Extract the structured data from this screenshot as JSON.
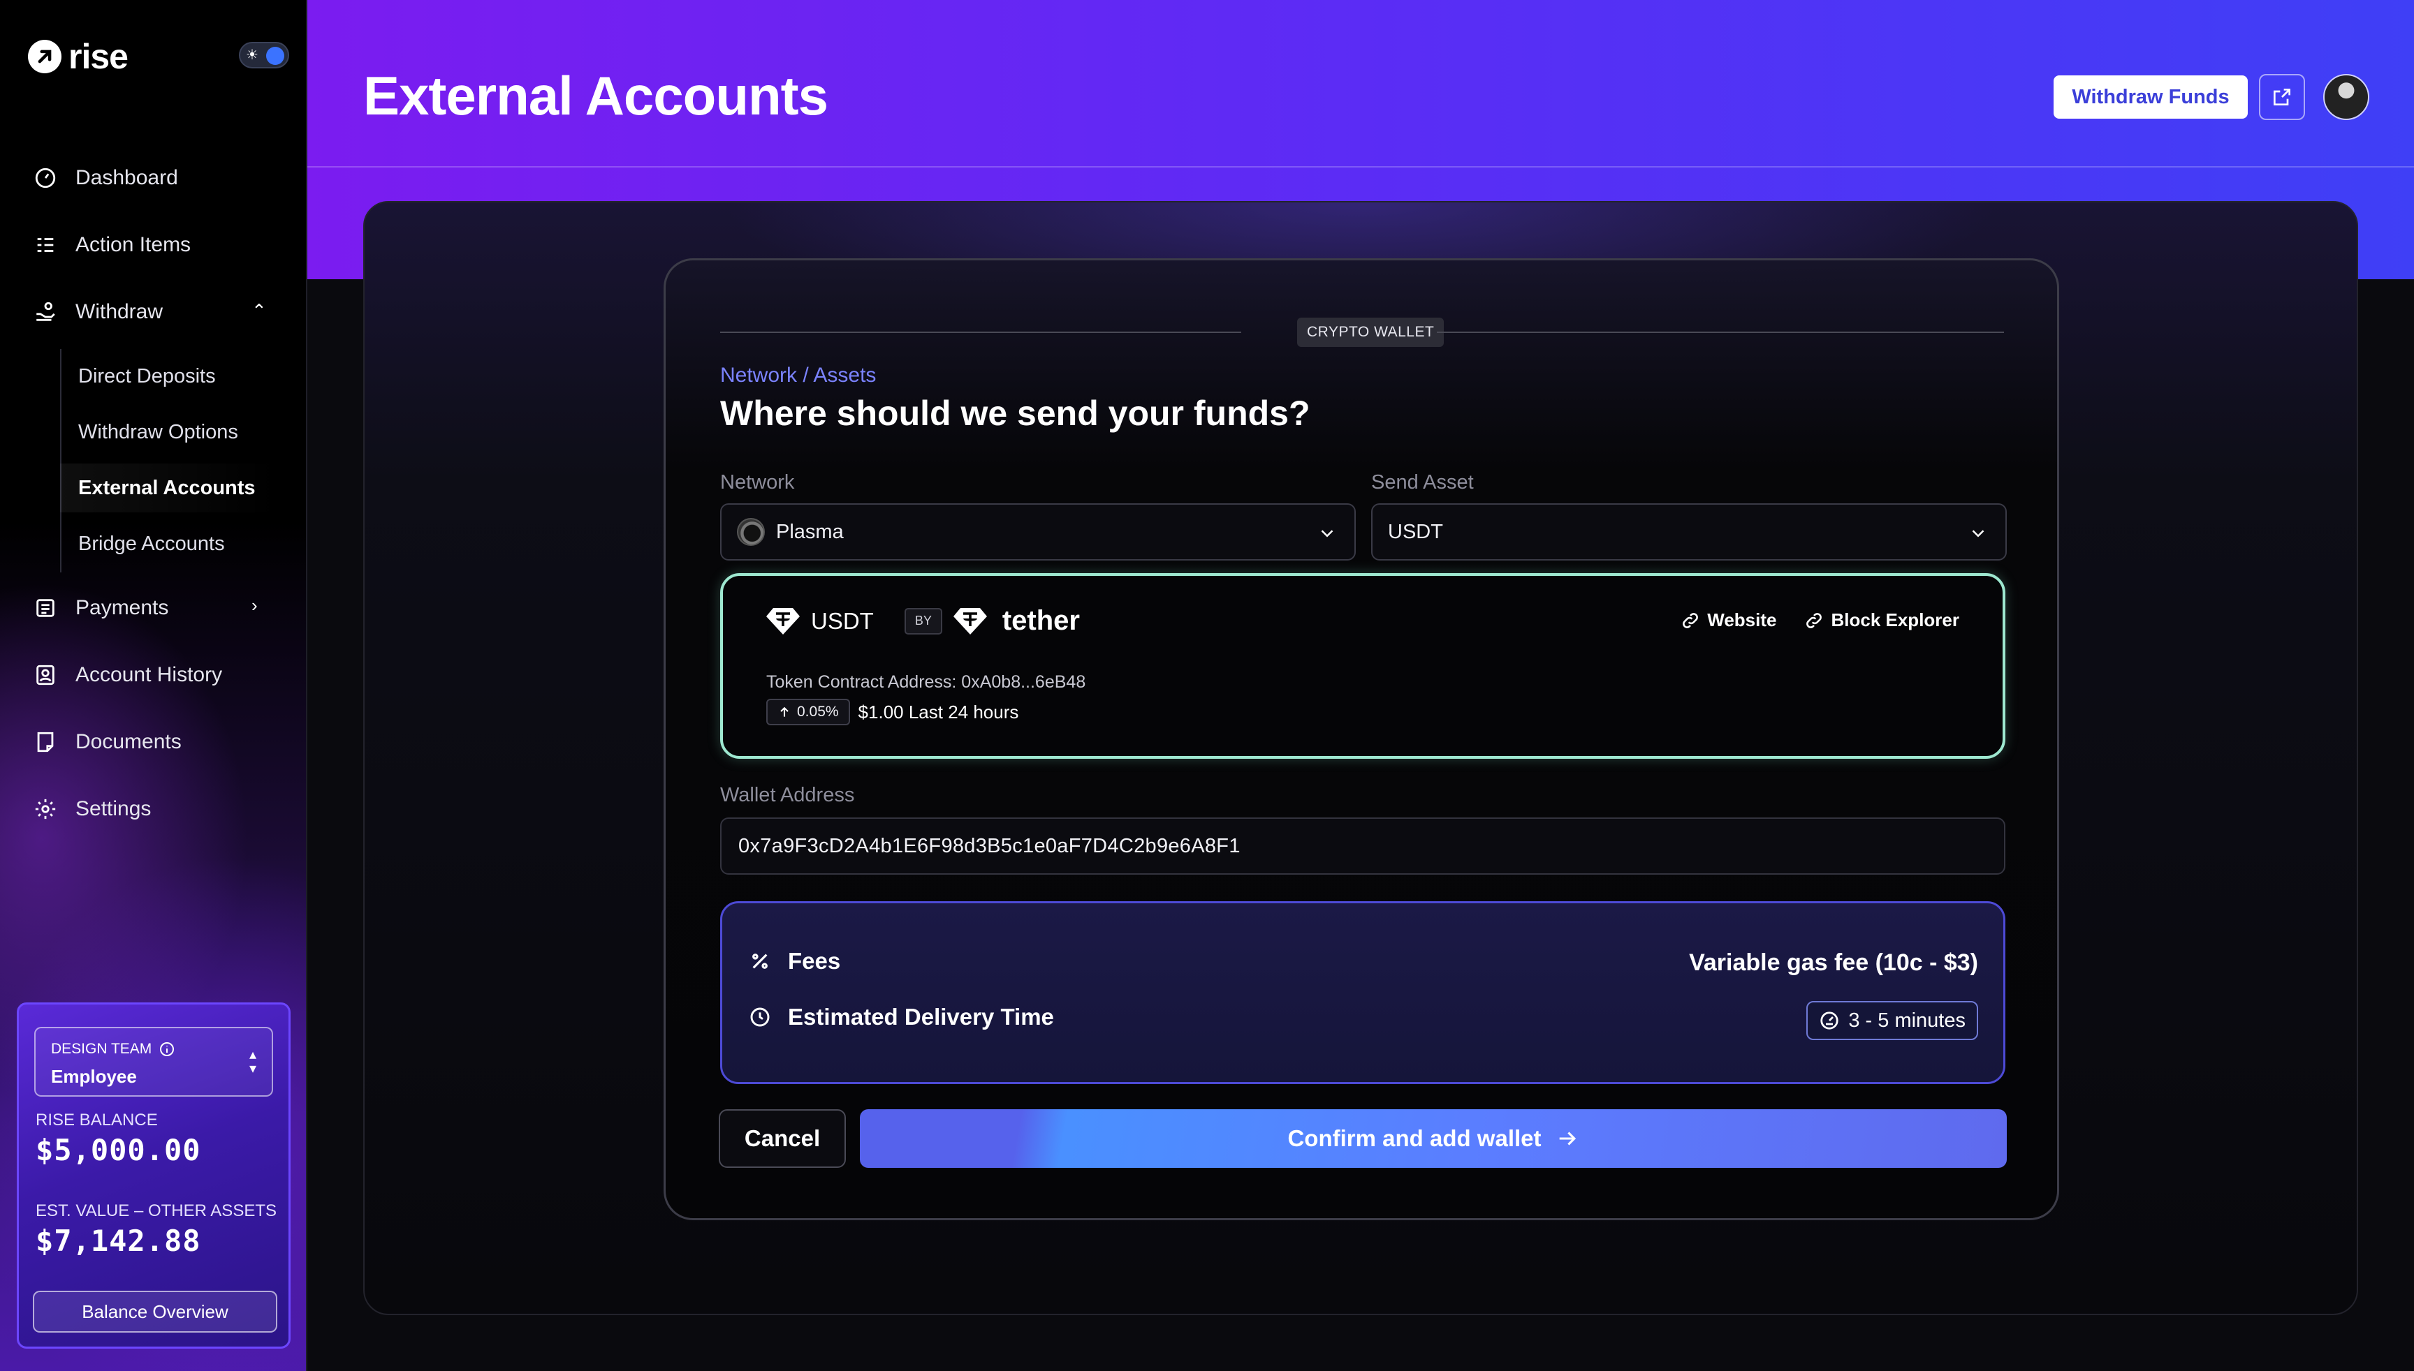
{
  "brand": {
    "name": "rise"
  },
  "sidebar": {
    "items": [
      {
        "label": "Dashboard",
        "icon": "dashboard-gauge-icon"
      },
      {
        "label": "Action Items",
        "icon": "checklist-icon"
      },
      {
        "label": "Withdraw",
        "icon": "hand-coins-icon",
        "expanded": true
      },
      {
        "label": "Payments",
        "icon": "receipt-list-icon",
        "expanded": false
      },
      {
        "label": "Account History",
        "icon": "user-book-icon"
      },
      {
        "label": "Documents",
        "icon": "document-icon"
      },
      {
        "label": "Settings",
        "icon": "gear-icon"
      }
    ],
    "withdraw_subitems": [
      "Direct Deposits",
      "Withdraw Options",
      "External Accounts",
      "Bridge Accounts"
    ],
    "active_subitem": "External Accounts"
  },
  "balance_card": {
    "team_label": "DESIGN TEAM",
    "team_role": "Employee",
    "rise_balance_label": "RISE BALANCE",
    "rise_balance": "$5,000.00",
    "other_assets_label": "EST. VALUE – OTHER ASSETS",
    "other_assets": "$7,142.88",
    "button_label": "Balance Overview"
  },
  "header": {
    "title": "External Accounts",
    "withdraw_button": "Withdraw Funds"
  },
  "wallet_form": {
    "section_label": "CRYPTO WALLET",
    "breadcrumb": "Network / Assets",
    "heading": "Where should we send your funds?",
    "network_label": "Network",
    "network_value": "Plasma",
    "asset_label": "Send Asset",
    "asset_value": "USDT",
    "token": {
      "symbol": "USDT",
      "by": "BY",
      "issuer": "tether",
      "website_link": "Website",
      "explorer_link": "Block Explorer",
      "contract": "Token Contract Address: 0xA0b8...6eB48",
      "change": "0.05%",
      "price_text": "$1.00 Last 24 hours"
    },
    "wallet_label": "Wallet Address",
    "wallet_value": "0x7a9F3cD2A4b1E6F98d3B5c1e0aF7D4C2b9e6A8F1",
    "fees_label": "Fees",
    "fees_value": "Variable gas  fee (10c - $3)",
    "delivery_label": "Estimated Delivery Time",
    "delivery_value": "3 - 5 minutes",
    "cancel_label": "Cancel",
    "confirm_label": "Confirm and add wallet"
  },
  "colors": {
    "header_gradient_start": "#7b1cf0",
    "header_gradient_end": "#3f3ff6",
    "accent_link": "#7b83ff",
    "token_border": "#9ee8d0",
    "confirm_button": "#5b7dff"
  }
}
